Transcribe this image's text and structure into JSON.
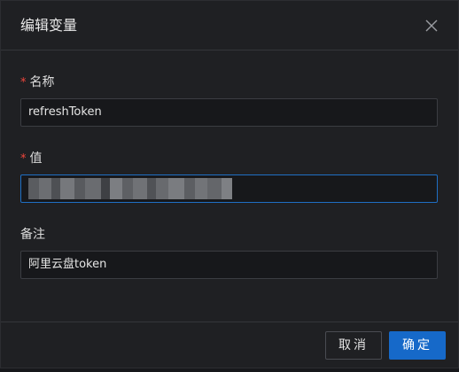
{
  "dialog": {
    "title": "编辑变量",
    "close_label": "X"
  },
  "fields": {
    "name": {
      "required_mark": "*",
      "label": "名称",
      "value": "refreshToken"
    },
    "value": {
      "required_mark": "*",
      "label": "值",
      "value_obscured": true
    },
    "note": {
      "label": "备注",
      "value": "阿里云盘token"
    }
  },
  "footer": {
    "cancel_label": "取消",
    "confirm_label": "确定"
  },
  "colors": {
    "accent": "#1669c9",
    "required": "#f0463c",
    "background": "#1f2023"
  }
}
